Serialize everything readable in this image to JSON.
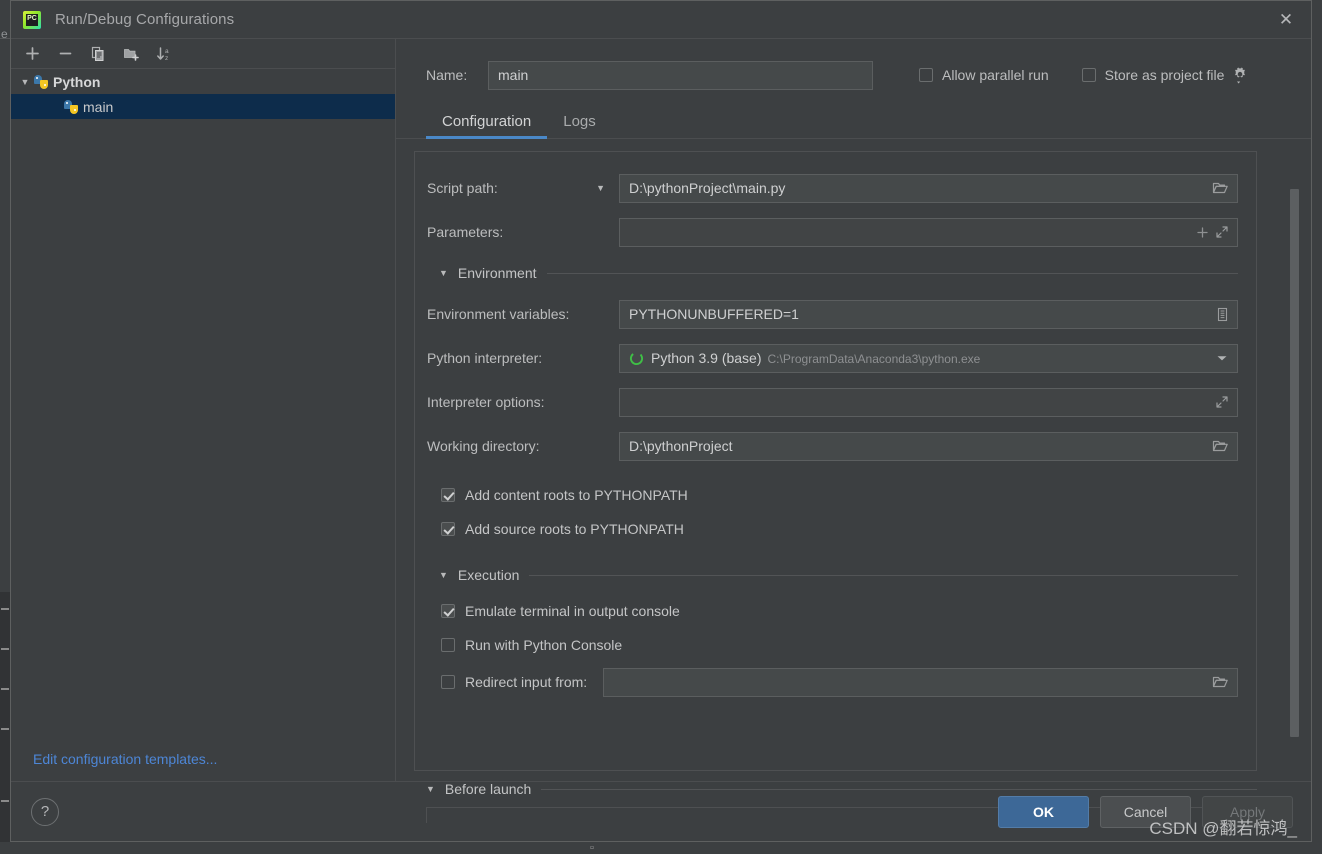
{
  "window": {
    "title": "Run/Debug Configurations",
    "app_icon": "pycharm-logo",
    "pc_text": "PC",
    "close_icon": "close-icon"
  },
  "left_panel": {
    "toolbar": [
      {
        "name": "add-configuration-button",
        "icon": "plus-icon"
      },
      {
        "name": "remove-configuration-button",
        "icon": "minus-icon"
      },
      {
        "name": "copy-configuration-button",
        "icon": "copy-icon"
      },
      {
        "name": "new-folder-button",
        "icon": "folder-plus-icon"
      },
      {
        "name": "sort-configurations-button",
        "icon": "sort-az-icon"
      }
    ],
    "tree": [
      {
        "label": "Python",
        "type": "group",
        "expanded": true,
        "icon": "python-icon",
        "selected": false
      },
      {
        "label": "main",
        "type": "item",
        "icon": "python-icon",
        "selected": true
      }
    ],
    "edit_templates_link": "Edit configuration templates..."
  },
  "header": {
    "name_label": "Name:",
    "name_value": "main",
    "name_placeholder": "",
    "allow_parallel_run": {
      "label": "Allow parallel run",
      "checked": false
    },
    "store_as_project_file": {
      "label": "Store as project file",
      "checked": false
    },
    "gear_icon": "gear-dropdown-icon"
  },
  "tabs": [
    {
      "label": "Configuration",
      "active": true
    },
    {
      "label": "Logs",
      "active": false
    }
  ],
  "form": {
    "script_path": {
      "label": "Script path:",
      "value": "D:\\pythonProject\\main.py",
      "has_dropdown_caret": true,
      "trailing_icon": "folder-open-icon"
    },
    "parameters": {
      "label": "Parameters:",
      "value": "",
      "placeholder": "",
      "trailing_icons": [
        "insert-macro-icon",
        "expand-icon"
      ]
    },
    "environment_section": {
      "label": "Environment",
      "expanded": true
    },
    "environment_variables": {
      "label": "Environment variables:",
      "value": "PYTHONUNBUFFERED=1",
      "trailing_icon": "edit-list-icon"
    },
    "python_interpreter": {
      "label": "Python interpreter:",
      "value": "Python 3.9 (base)",
      "path": "C:\\ProgramData\\Anaconda3\\python.exe",
      "status_icon": "python-env-icon",
      "trailing_icon": "chevron-down-icon"
    },
    "interpreter_options": {
      "label": "Interpreter options:",
      "value": "",
      "trailing_icon": "expand-icon"
    },
    "working_directory": {
      "label": "Working directory:",
      "value": "D:\\pythonProject",
      "trailing_icon": "folder-open-icon"
    },
    "add_content_roots": {
      "label": "Add content roots to PYTHONPATH",
      "checked": true
    },
    "add_source_roots": {
      "label": "Add source roots to PYTHONPATH",
      "checked": true
    },
    "execution_section": {
      "label": "Execution",
      "expanded": true
    },
    "emulate_terminal": {
      "label": "Emulate terminal in output console",
      "checked": true
    },
    "run_with_python_console": {
      "label": "Run with Python Console",
      "checked": false
    },
    "redirect_input_from": {
      "label": "Redirect input from:",
      "checked": false,
      "value": "",
      "trailing_icon": "folder-open-icon"
    },
    "before_launch_section": {
      "label": "Before launch",
      "expanded": true
    }
  },
  "footer": {
    "help_label": "?",
    "ok_label": "OK",
    "cancel_label": "Cancel",
    "apply_label": "Apply"
  },
  "watermark": "CSDN @翻若惊鸿_",
  "colors": {
    "dialog_bg": "#3c3f41",
    "input_bg": "#45494a",
    "selection_bg": "#0d2c4b",
    "accent_blue": "#4a88c7",
    "link_blue": "#4d86d6",
    "primary_button": "#3d6897",
    "text": "#bcbdbe"
  }
}
